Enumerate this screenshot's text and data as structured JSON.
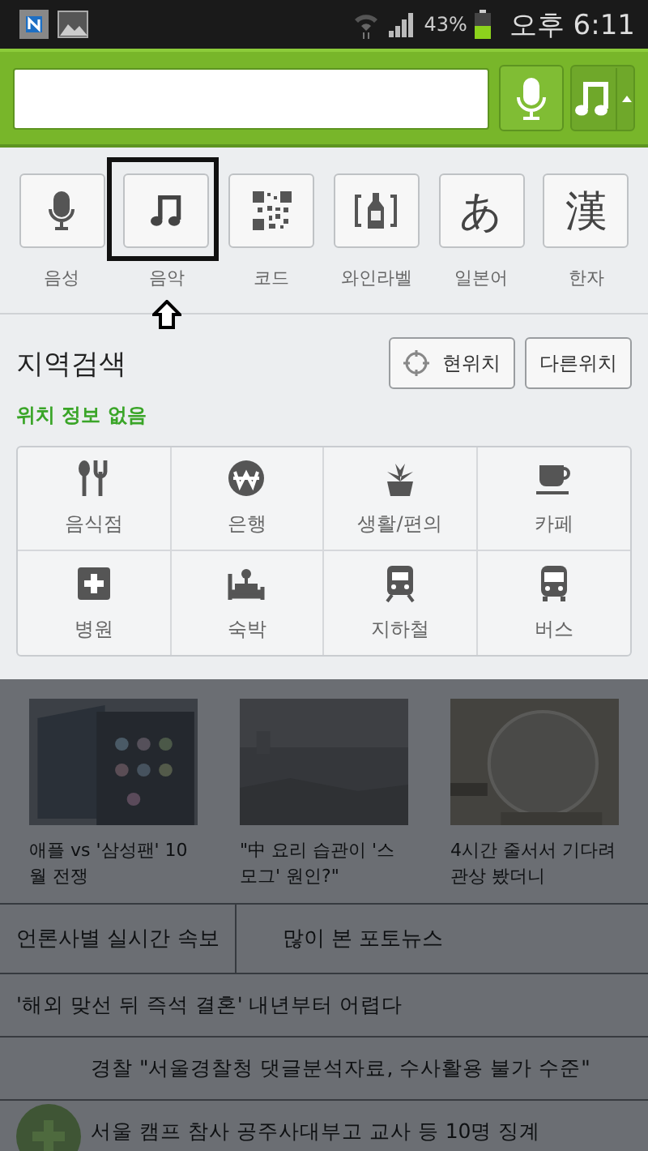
{
  "status_bar": {
    "battery": "43%",
    "time": "오후 6:11"
  },
  "tools": [
    {
      "kind": "icon",
      "label": "음성",
      "annotated": false
    },
    {
      "kind": "icon",
      "label": "음악",
      "annotated": true
    },
    {
      "kind": "icon",
      "label": "코드",
      "annotated": false
    },
    {
      "kind": "icon",
      "label": "와인라벨",
      "annotated": false
    },
    {
      "kind": "glyph",
      "glyph": "あ",
      "label": "일본어",
      "annotated": false
    },
    {
      "kind": "glyph",
      "glyph": "漢",
      "label": "한자",
      "annotated": false
    }
  ],
  "local_search": {
    "title": "지역검색",
    "status": "위치 정보 없음",
    "buttons": [
      {
        "kind": "locate",
        "label": "현위치"
      },
      {
        "kind": "plain",
        "label": "다른위치"
      }
    ],
    "categories": [
      {
        "label": "음식점"
      },
      {
        "label": "은행"
      },
      {
        "label": "생활/편의"
      },
      {
        "label": "카페"
      },
      {
        "label": "병원"
      },
      {
        "label": "숙박"
      },
      {
        "label": "지하철"
      },
      {
        "label": "버스"
      }
    ]
  },
  "news": {
    "photos": [
      {
        "kind": "picture",
        "caption": "애플 vs '삼성팬' 10월 전쟁"
      },
      {
        "kind": "picture",
        "caption": "\"中 요리 습관이 '스모그' 원인?\""
      },
      {
        "kind": "picture",
        "caption": "4시간 줄서서 기다려 관상 봤더니"
      }
    ],
    "tabs": [
      {
        "label": "언론사별 실시간 속보"
      },
      {
        "label": "많이 본 포토뉴스"
      }
    ],
    "headlines": [
      "'해외 맞선 뒤 즉석 결혼' 내년부터 어렵다",
      "경찰 \"서울경찰청 댓글분석자료, 수사활용 불가 수준\"",
      "서울 캠프 참사 공주사대부고 교사 등 10명 징계"
    ]
  }
}
